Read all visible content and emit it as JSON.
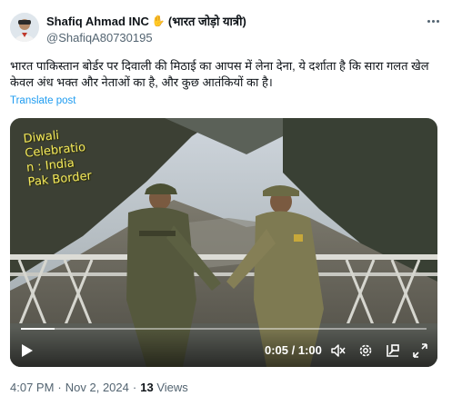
{
  "author": {
    "display_name": "Shafiq Ahmad INC",
    "hand_emoji": "✋",
    "tagline": "(भारत जोड़ो यात्री)",
    "handle": "@ShafiqA80730195"
  },
  "tweet": {
    "text": "भारत पाकिस्तान बोर्डर पर दिवाली की मिठाई का आपस में लेना देना, ये दर्शाता है कि सारा गलत खेल केवल अंध भक्त और नेताओं का है, और कुछ आतंकियों का है।",
    "translate_label": "Translate post"
  },
  "video": {
    "caption": "Diwali\nCelebratio\nn : India\nPak Border",
    "current_time": "0:05",
    "duration": "1:00",
    "time_display": "0:05 / 1:00",
    "progress_fraction": 0.083
  },
  "meta": {
    "time": "4:07 PM",
    "date": "Nov 2, 2024",
    "views_count": "13",
    "views_label": "Views"
  },
  "icons": [
    "avatar",
    "more-dots-icon",
    "play-icon",
    "mute-icon",
    "settings-gear-icon",
    "pip-icon",
    "fullscreen-icon"
  ]
}
